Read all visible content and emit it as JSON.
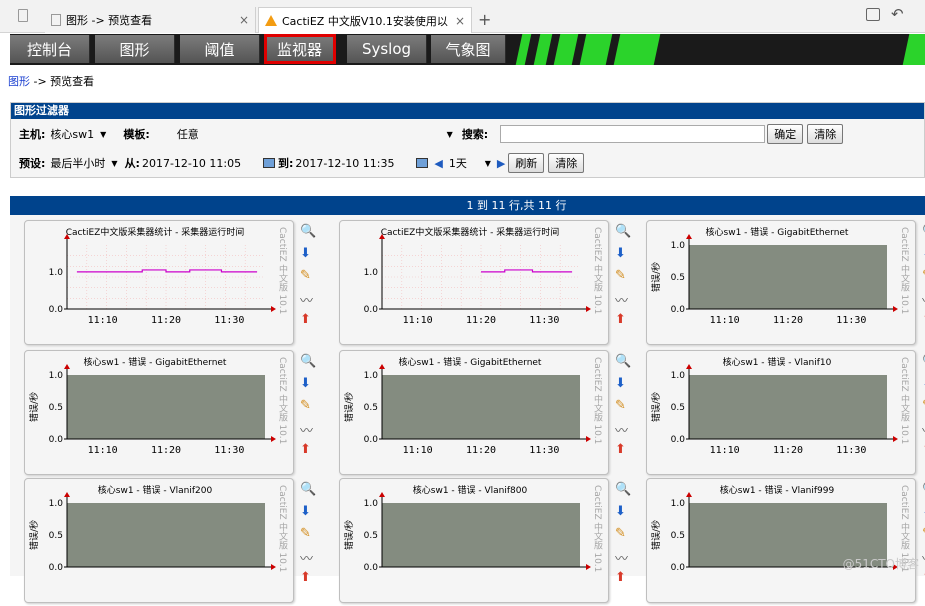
{
  "browser": {
    "tabs": [
      {
        "title": "图形 -> 预览查看"
      },
      {
        "title": "CactiEZ 中文版V10.1安装使用以"
      }
    ],
    "new_tab": "+"
  },
  "nav": {
    "items": [
      "控制台",
      "图形",
      "阈值",
      "监视器",
      "Syslog",
      "气象图"
    ],
    "selected": "监视器",
    "accent": "#e00000"
  },
  "breadcrumb": {
    "link": "图形",
    "rest": "-> 预览查看"
  },
  "filter": {
    "title": "图形过滤器",
    "host_label": "主机:",
    "host_value": "核心sw1",
    "template_label": "模板:",
    "template_value": "任意",
    "search_label": "搜索:",
    "search_value": "",
    "ok_button": "确定",
    "clear_button": "清除",
    "preset_label": "预设:",
    "preset_value": "最后半小时",
    "from_label": "从:",
    "from_value": "2017-12-10 11:05",
    "to_label": "到:",
    "to_value": "2017-12-10 11:35",
    "timespan_value": "1天",
    "refresh_button": "刷新",
    "clear2_button": "清除"
  },
  "results": {
    "summary": "1 到 11 行,共 11 行"
  },
  "graphs": [
    {
      "title": "CactiEZ中文版采集器统计 - 采集器运行时间",
      "ylabel": "",
      "yticks": [
        "1.0",
        "0.0"
      ],
      "xticks": [
        "11:10",
        "11:20",
        "11:30"
      ],
      "kind": "line",
      "series_color": "#cc00cc"
    },
    {
      "title": "CactiEZ中文版采集器统计 - 采集器运行时间",
      "ylabel": "",
      "yticks": [
        "1.0",
        "0.0"
      ],
      "xticks": [
        "11:10",
        "11:20",
        "11:30"
      ],
      "kind": "line",
      "series_color": "#cc00cc"
    },
    {
      "title": "核心sw1 - 错误 - GigabitEthernet",
      "ylabel": "错误/秒",
      "yticks": [
        "1.0",
        "0.5",
        "0.0"
      ],
      "xticks": [
        "11:10",
        "11:20",
        "11:30"
      ],
      "kind": "area"
    },
    {
      "title": "核心sw1 - 错误 - GigabitEthernet",
      "ylabel": "错误/秒",
      "yticks": [
        "1.0",
        "0.5",
        "0.0"
      ],
      "xticks": [
        "11:10",
        "11:20",
        "11:30"
      ],
      "kind": "area"
    },
    {
      "title": "核心sw1 - 错误 - GigabitEthernet",
      "ylabel": "错误/秒",
      "yticks": [
        "1.0",
        "0.5",
        "0.0"
      ],
      "xticks": [
        "11:10",
        "11:20",
        "11:30"
      ],
      "kind": "area"
    },
    {
      "title": "核心sw1 - 错误 - Vlanif10",
      "ylabel": "错误/秒",
      "yticks": [
        "1.0",
        "0.5",
        "0.0"
      ],
      "xticks": [
        "11:10",
        "11:20",
        "11:30"
      ],
      "kind": "area"
    },
    {
      "title": "核心sw1 - 错误 - Vlanif200",
      "ylabel": "错误/秒",
      "yticks": [
        "1.0",
        "0.5",
        "0.0"
      ],
      "xticks": [],
      "kind": "area"
    },
    {
      "title": "核心sw1 - 错误 - Vlanif800",
      "ylabel": "错误/秒",
      "yticks": [
        "1.0",
        "0.5",
        "0.0"
      ],
      "xticks": [],
      "kind": "area"
    },
    {
      "title": "核心sw1 - 错误 - Vlanif999",
      "ylabel": "错误/秒",
      "yticks": [
        "1.0",
        "0.5",
        "0.0"
      ],
      "xticks": [],
      "kind": "area"
    }
  ],
  "graph_side_label": "CactiEZ 中文版 10.1",
  "graph_actions": [
    "zoom-icon",
    "down-icon",
    "edit-icon",
    "trend-icon",
    "up-icon"
  ],
  "area_color": "#848c80",
  "watermark": "@51CTO博客"
}
